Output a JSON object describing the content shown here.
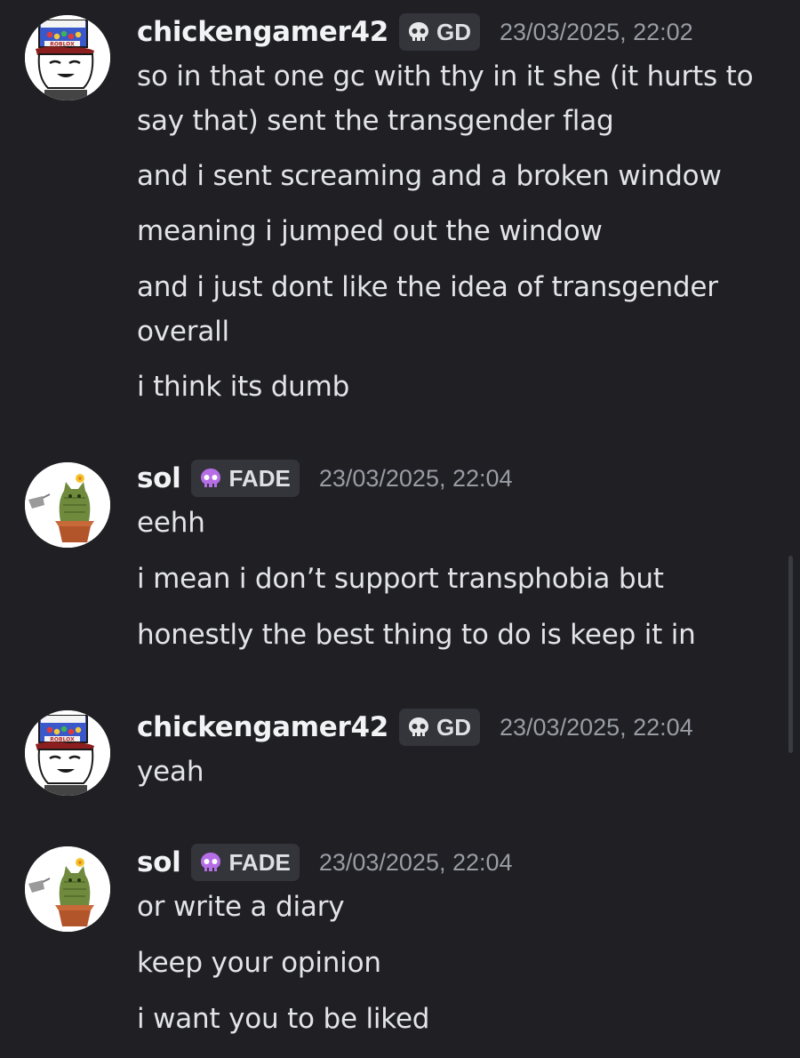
{
  "colors": {
    "background": "#1f1f24",
    "username": "#f2f3f5",
    "message_text": "#e3e4e8",
    "timestamp": "#9a9ca4",
    "tag_background": "#34353b",
    "fade_tag_icon": "#b56ee6",
    "gd_tag_icon": "#e9e9ec"
  },
  "messages": [
    {
      "username": "chickengamer42",
      "tag": {
        "icon": "skull-icon",
        "label": "GD"
      },
      "timestamp": "23/03/2025, 22:02",
      "avatar": "roblox-character-avatar",
      "lines": [
        "so in that one gc with thy in it she (it hurts to say that) sent the transgender flag",
        "and i sent screaming and a broken window",
        "meaning i jumped out the window",
        "and i just dont like the idea of transgender overall",
        "i think its dumb"
      ]
    },
    {
      "username": "sol",
      "tag": {
        "icon": "purple-skull-icon",
        "label": "FADE"
      },
      "timestamp": "23/03/2025, 22:04",
      "avatar": "cat-in-flowerpot-avatar",
      "lines": [
        "eehh",
        "i mean i don’t support transphobia but",
        "honestly the best thing to do is keep it in"
      ]
    },
    {
      "username": "chickengamer42",
      "tag": {
        "icon": "skull-icon",
        "label": "GD"
      },
      "timestamp": "23/03/2025, 22:04",
      "avatar": "roblox-character-avatar",
      "lines": [
        "yeah"
      ]
    },
    {
      "username": "sol",
      "tag": {
        "icon": "purple-skull-icon",
        "label": "FADE"
      },
      "timestamp": "23/03/2025, 22:04",
      "avatar": "cat-in-flowerpot-avatar",
      "lines": [
        "or write a diary",
        "keep your opinion",
        "i want you to be liked"
      ]
    }
  ]
}
